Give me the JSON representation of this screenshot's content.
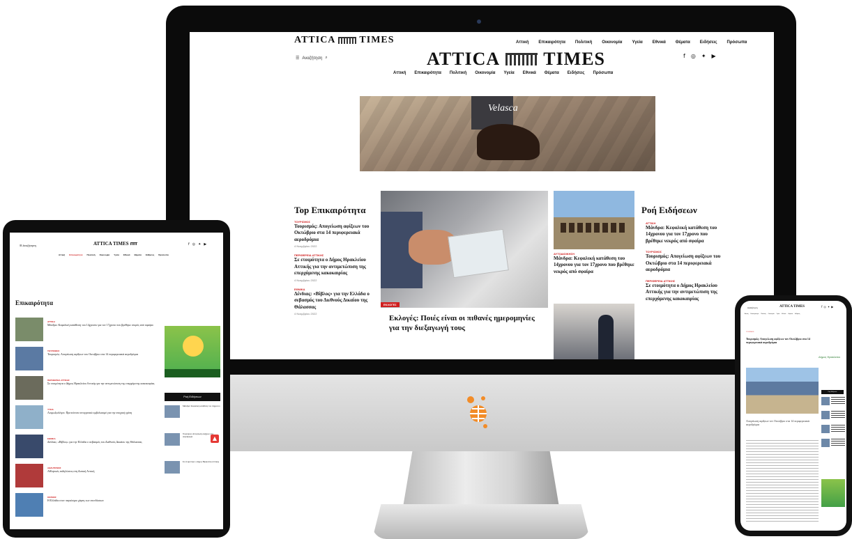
{
  "desktop": {
    "logo_left": "ATTICA",
    "logo_right": "TIMES",
    "search_label": "Αναζήτηση",
    "top_menu": [
      "Αττική",
      "Επικαιρότητα",
      "Πολιτική",
      "Οικονομία",
      "Υγεία",
      "Εθνικά",
      "Θέματα",
      "Ειδήσεις",
      "Πρόσωπα"
    ],
    "main_menu": [
      "Αττική",
      "Επικαιρότητα",
      "Πολιτική",
      "Οικονομία",
      "Υγεία",
      "Εθνικά",
      "Θέματα",
      "Ειδήσεις",
      "Πρόσωπα"
    ],
    "social_icons": [
      "facebook-icon",
      "instagram-icon",
      "twitter-icon",
      "youtube-icon"
    ],
    "ad_brand": "Velasca",
    "top_section_title": "Top Επικαιρότητα",
    "top_items": [
      {
        "tag": "ΤΟΥΡΙΣΜΟΣ",
        "headline": "Τουρισμός: Απογείωση αφίξεων του Οκτώβριο στα 14 περιφερειακά αεροδρόμια",
        "date": "4 Νοεμβρίου 2022"
      },
      {
        "tag": "ΠΕΡΙΦΕΡΕΙΑ ΑΤΤΙΚΗΣ",
        "headline": "Σε ετοιμότητα ο Δήμος Ηρακλείου Αττικής για την αντιμετώπιση της επερχόμενης κακοκαιρίας",
        "date": "4 Νοεμβρίου 2022"
      },
      {
        "tag": "ΕΘΝΙΚΑ",
        "headline": "Δένδιας: «Βίβλος» για την Ελλάδα ο σεβασμός του Διεθνούς Δικαίου της Θάλασσας",
        "date": "4 Νοεμβρίου 2022"
      }
    ],
    "hero_tag": "ΕΚΛΟΓΕΣ",
    "hero_headline": "Εκλογές: Ποιές είναι οι πιθανές ημερομηνίες για την διεξαγωγή τους",
    "mid_tag": "ΑΥΤΟΔΙΟΙΚΗΣΗ",
    "mid_headline": "Μάνδρα: Κεφαλική κατάθεση του 14χρονου για τον 17χρονο που βρέθηκε νεκρός από σφαίρα",
    "flow_title": "Ροή Ειδήσεων",
    "flow_items": [
      {
        "tag": "ΑΤΤΙΚΗ",
        "headline": "Μάνδρα: Κεφαλική κατάθεση του 14χρονου για τον 17χρονο που βρέθηκε νεκρός από σφαίρα"
      },
      {
        "tag": "ΤΟΥΡΙΣΜΟΣ",
        "headline": "Τουρισμός: Απογείωση αφίξεων του Οκτώβριο στα 14 περιφερειακά αεροδρόμια"
      },
      {
        "tag": "ΠΕΡΙΦΕΡΕΙΑ ΑΤΤΙΚΗΣ",
        "headline": "Σε ετοιμότητα ο Δήμος Ηρακλείου Αττικής για την αντιμετώπιση της επερχόμενης κακοκαιρίας"
      }
    ]
  },
  "tablet": {
    "logo": "ATTICA TIMES",
    "search_label": "Αναζήτηση",
    "menu": [
      "Αττική",
      "Επικαιρότητα",
      "Πολιτική",
      "Οικονομία",
      "Υγεία",
      "Εθνικά",
      "Θέματα",
      "Ειδήσεις",
      "Πρόσωπα"
    ],
    "section_title": "Επικαιρότητα",
    "rows": [
      {
        "tag": "ΑΤΤΙΚΗ",
        "headline": "Μάνδρα: Κεφαλική κατάθεση του 14χρονου για τον 17χρονο που βρέθηκε νεκρός από σφαίρα",
        "thumb": "#7a8c6a"
      },
      {
        "tag": "ΤΟΥΡΙΣΜΟΣ",
        "headline": "Τουρισμός: Απογείωση αφίξεων του Οκτώβριο στα 14 περιφερειακά αεροδρόμια",
        "thumb": "#5b7aa3"
      },
      {
        "tag": "ΠΕΡΙΦΕΡΕΙΑ ΑΤΤΙΚΗΣ",
        "headline": "Σε ετοιμότητα ο Δήμος Ηρακλείου Αττικής για την αντιμετώπιση της επερχόμενης κακοκαιρίας",
        "thumb": "#6b6b5c"
      },
      {
        "tag": "ΥΓΕΙΑ",
        "headline": "Λοιμωξιολόγοι: Προτείνουν αντιγριπικό εμβολιασμό για την εποχική γρίπη",
        "thumb": "#8fb0c9"
      },
      {
        "tag": "ΕΘΝΙΚΑ",
        "headline": "Δένδιας: «Βίβλος» για την Ελλάδα ο σεβασμός του Διεθνούς Δικαίου της Θάλασσας",
        "thumb": "#394a6b"
      },
      {
        "tag": "ΑΘΛΗΤΙΣΜΟΣ",
        "headline": "Αθλητικές εκδηλώσεις στη Δυτική Αττική",
        "thumb": "#b03a3a"
      },
      {
        "tag": "ΚΟΣΜΟΣ",
        "headline": "Η Ελλάδα στον παγκόσμιο χάρτη των επενδύσεων",
        "thumb": "#4f7fb3"
      }
    ],
    "news_head": "Ροή Ειδήσεων",
    "side": [
      "Μάνδρα: Κεφαλική κατάθεση του 14χρονου",
      "Τουρισμός: Απογείωση αφίξεων στα αεροδρόμια",
      "Σε ετοιμότητα ο Δήμος Ηρακλείου Αττικής"
    ],
    "up_arrow": "▲"
  },
  "phone": {
    "search_label": "Αναζήτηση",
    "logo": "ATTICA TIMES",
    "menu": [
      "Αττική",
      "Επικαιρότητα",
      "Πολιτική",
      "Οικονομία",
      "Υγεία",
      "Εθνικά",
      "Θέματα",
      "Ειδήσεις"
    ],
    "tag": "ΤΟΥΡΙΣΜΟΣ",
    "title": "Τουρισμός: Απογείωση αφίξεων τον Οκτώβριο στα 14 περιφερειακά αεροδρόμια",
    "ad_label": "Δήμος Ηρακλείου",
    "side_head": "Ροή Ειδήσεων",
    "body_title": "Απογείωση αφίξεων τον Οκτώβριο στα 14 περιφερειακά αεροδρόμια"
  }
}
